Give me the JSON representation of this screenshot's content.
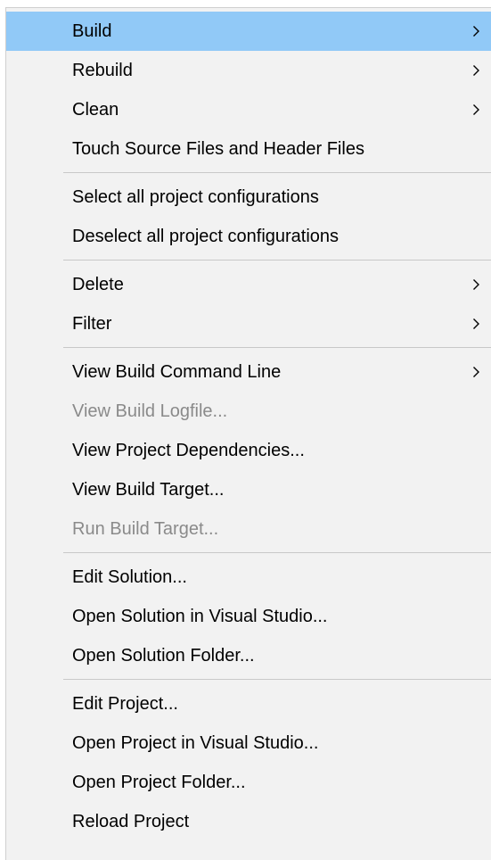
{
  "menu": {
    "groups": [
      [
        {
          "label": "Build",
          "submenu": true,
          "enabled": true,
          "highlighted": true
        },
        {
          "label": "Rebuild",
          "submenu": true,
          "enabled": true
        },
        {
          "label": "Clean",
          "submenu": true,
          "enabled": true
        },
        {
          "label": "Touch Source Files and Header Files",
          "submenu": false,
          "enabled": true
        }
      ],
      [
        {
          "label": "Select all project configurations",
          "submenu": false,
          "enabled": true
        },
        {
          "label": "Deselect all project configurations",
          "submenu": false,
          "enabled": true
        }
      ],
      [
        {
          "label": "Delete",
          "submenu": true,
          "enabled": true
        },
        {
          "label": "Filter",
          "submenu": true,
          "enabled": true
        }
      ],
      [
        {
          "label": "View Build Command Line",
          "submenu": true,
          "enabled": true
        },
        {
          "label": "View Build Logfile...",
          "submenu": false,
          "enabled": false
        },
        {
          "label": "View Project Dependencies...",
          "submenu": false,
          "enabled": true
        },
        {
          "label": "View Build Target...",
          "submenu": false,
          "enabled": true
        },
        {
          "label": "Run Build Target...",
          "submenu": false,
          "enabled": false
        }
      ],
      [
        {
          "label": "Edit Solution...",
          "submenu": false,
          "enabled": true
        },
        {
          "label": "Open Solution in Visual Studio...",
          "submenu": false,
          "enabled": true
        },
        {
          "label": "Open Solution Folder...",
          "submenu": false,
          "enabled": true
        }
      ],
      [
        {
          "label": "Edit Project...",
          "submenu": false,
          "enabled": true
        },
        {
          "label": "Open Project in Visual Studio...",
          "submenu": false,
          "enabled": true
        },
        {
          "label": "Open Project Folder...",
          "submenu": false,
          "enabled": true
        },
        {
          "label": "Reload Project",
          "submenu": false,
          "enabled": true
        }
      ]
    ],
    "colors": {
      "background": "#f2f2f2",
      "highlight": "#91c9f7",
      "text": "#000000",
      "disabled_text": "#8a8a8a",
      "separator": "#c8c8c8"
    },
    "icons": {
      "submenu_arrow": "chevron-right-icon"
    }
  }
}
